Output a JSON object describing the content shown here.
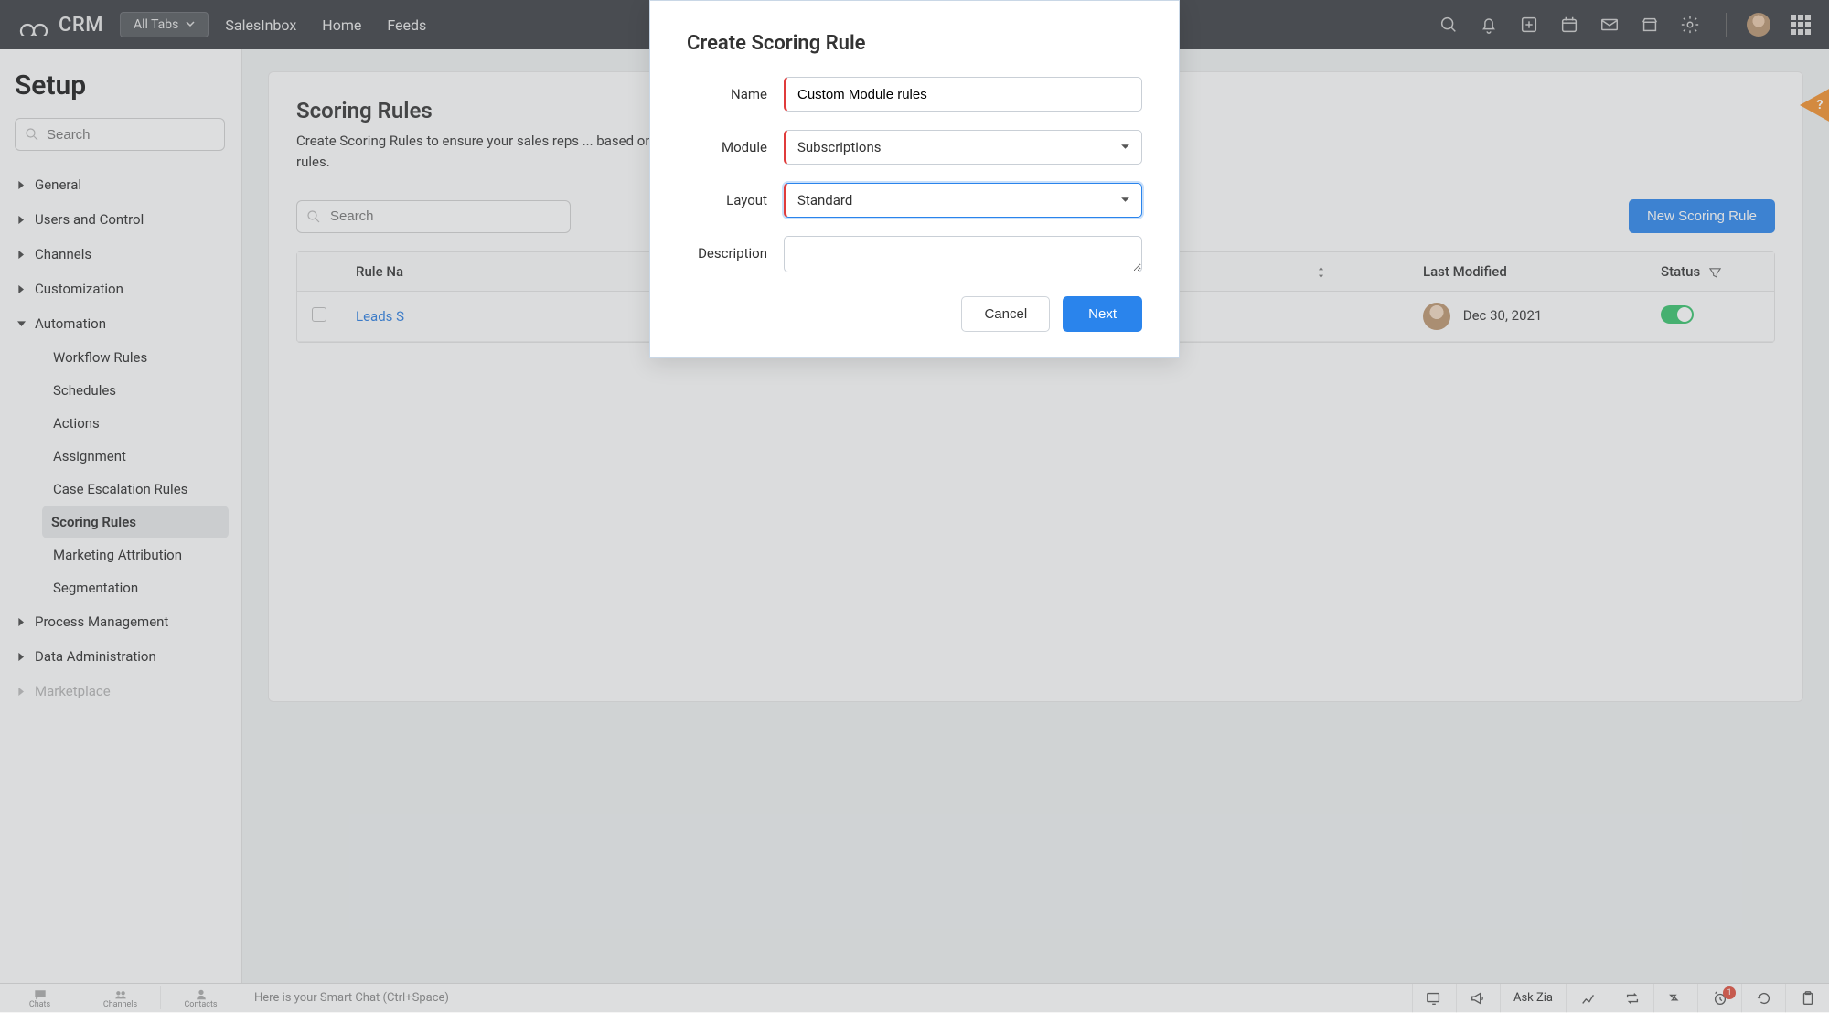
{
  "brand": "CRM",
  "topbar": {
    "all_tabs": "All Tabs",
    "nav": [
      "SalesInbox",
      "Home",
      "Feeds"
    ]
  },
  "sidebar": {
    "title": "Setup",
    "search_placeholder": "Search",
    "sections": [
      {
        "label": "General",
        "expanded": false
      },
      {
        "label": "Users and Control",
        "expanded": false
      },
      {
        "label": "Channels",
        "expanded": false
      },
      {
        "label": "Customization",
        "expanded": false
      },
      {
        "label": "Automation",
        "expanded": true,
        "children": [
          {
            "label": "Workflow Rules"
          },
          {
            "label": "Schedules"
          },
          {
            "label": "Actions"
          },
          {
            "label": "Assignment"
          },
          {
            "label": "Case Escalation Rules"
          },
          {
            "label": "Scoring Rules",
            "active": true
          },
          {
            "label": "Marketing Attribution"
          },
          {
            "label": "Segmentation"
          }
        ]
      },
      {
        "label": "Process Management",
        "expanded": false
      },
      {
        "label": "Data Administration",
        "expanded": false
      },
      {
        "label": "Marketplace",
        "expanded": false
      }
    ]
  },
  "content": {
    "title": "Scoring Rules",
    "description": "Create Scoring Rules to ensure your sales reps ... based on their profile and your customer's interactions. If you h... rules.",
    "search_placeholder": "Search",
    "new_button": "New Scoring Rule",
    "table": {
      "headers": {
        "rule_name": "Rule Na",
        "unknown_sorted": "",
        "last_modified": "Last Modified",
        "status": "Status"
      },
      "rows": [
        {
          "selected": false,
          "name": "Leads S",
          "last_modified": "Dec 30, 2021",
          "status_on": true
        }
      ]
    }
  },
  "modal": {
    "title": "Create Scoring Rule",
    "fields": {
      "name_label": "Name",
      "name_value": "Custom Module rules",
      "module_label": "Module",
      "module_value": "Subscriptions",
      "layout_label": "Layout",
      "layout_value": "Standard",
      "description_label": "Description",
      "description_value": ""
    },
    "cancel": "Cancel",
    "next": "Next"
  },
  "bottombar": {
    "tabs": [
      {
        "label": "Chats"
      },
      {
        "label": "Channels"
      },
      {
        "label": "Contacts"
      }
    ],
    "smart_hint": "Here is your Smart Chat (Ctrl+Space)",
    "ask_zia": "Ask Zia",
    "badge": "1"
  }
}
